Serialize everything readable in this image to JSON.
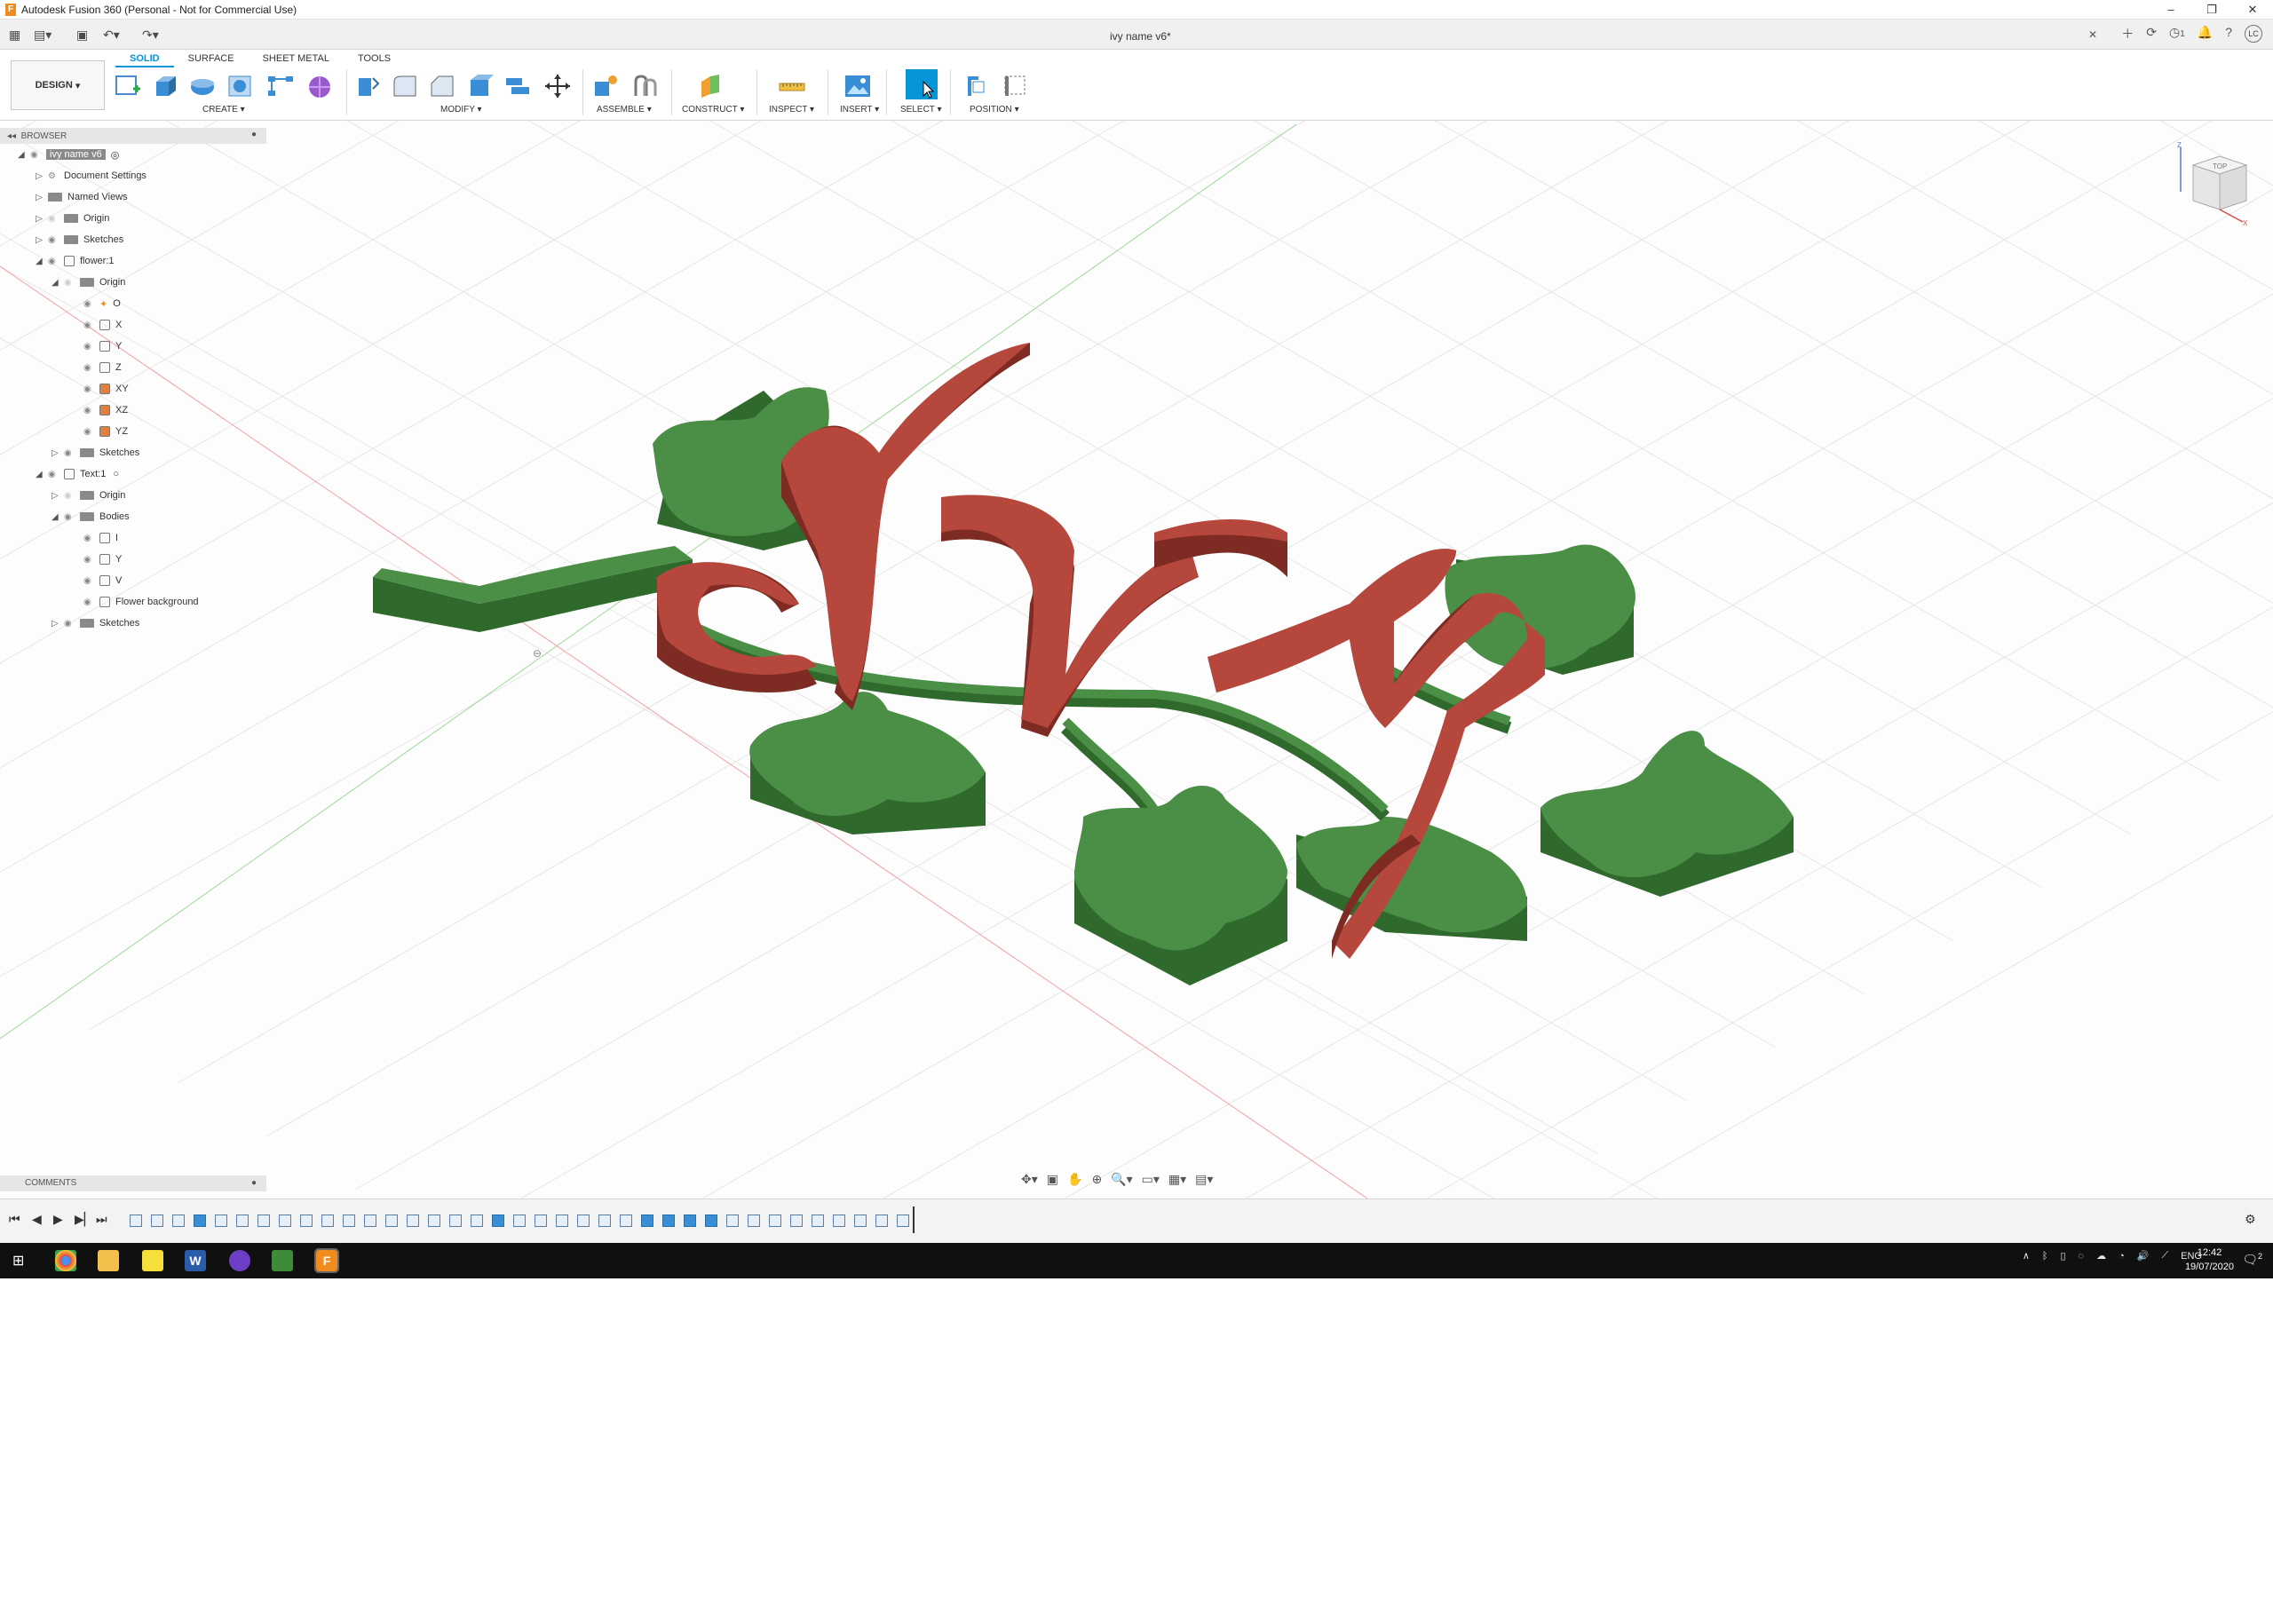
{
  "window": {
    "title": "Autodesk Fusion 360 (Personal - Not for Commercial Use)",
    "document_tab": "ivy name v6*"
  },
  "ribbon": {
    "workspace": "DESIGN",
    "tabs": [
      "SOLID",
      "SURFACE",
      "SHEET METAL",
      "TOOLS"
    ],
    "groups": {
      "create": "CREATE",
      "modify": "MODIFY",
      "assemble": "ASSEMBLE",
      "construct": "CONSTRUCT",
      "inspect": "INSPECT",
      "insert": "INSERT",
      "select": "SELECT",
      "position": "POSITION"
    }
  },
  "header_right": {
    "jobs_count": "1",
    "user_initials": "LC"
  },
  "browser": {
    "title": "BROWSER",
    "root": "ivy name v6",
    "items": {
      "document_settings": "Document Settings",
      "named_views": "Named Views",
      "origin": "Origin",
      "sketches": "Sketches",
      "flower": "flower:1",
      "flower_origin": "Origin",
      "o": "O",
      "x": "X",
      "y": "Y",
      "z": "Z",
      "xy": "XY",
      "xz": "XZ",
      "yz": "YZ",
      "flower_sketches": "Sketches",
      "text": "Text:1",
      "text_origin": "Origin",
      "bodies": "Bodies",
      "body_i": "I",
      "body_y1": "Y",
      "body_v": "V",
      "flower_background": "Flower background",
      "text_sketches": "Sketches"
    }
  },
  "comments": {
    "title": "COMMENTS"
  },
  "viewcube": {
    "face": "TOP",
    "axis_x": "X",
    "axis_z": "Z"
  },
  "taskbar": {
    "language": "ENG",
    "time": "12:42",
    "date": "19/07/2020",
    "notifications": "2"
  },
  "colors": {
    "accent": "#0696d7",
    "leaf_green": "#4b8f46",
    "leaf_dark": "#2f6a2c",
    "letter_red": "#b5473c",
    "letter_dark": "#7e2b24"
  }
}
